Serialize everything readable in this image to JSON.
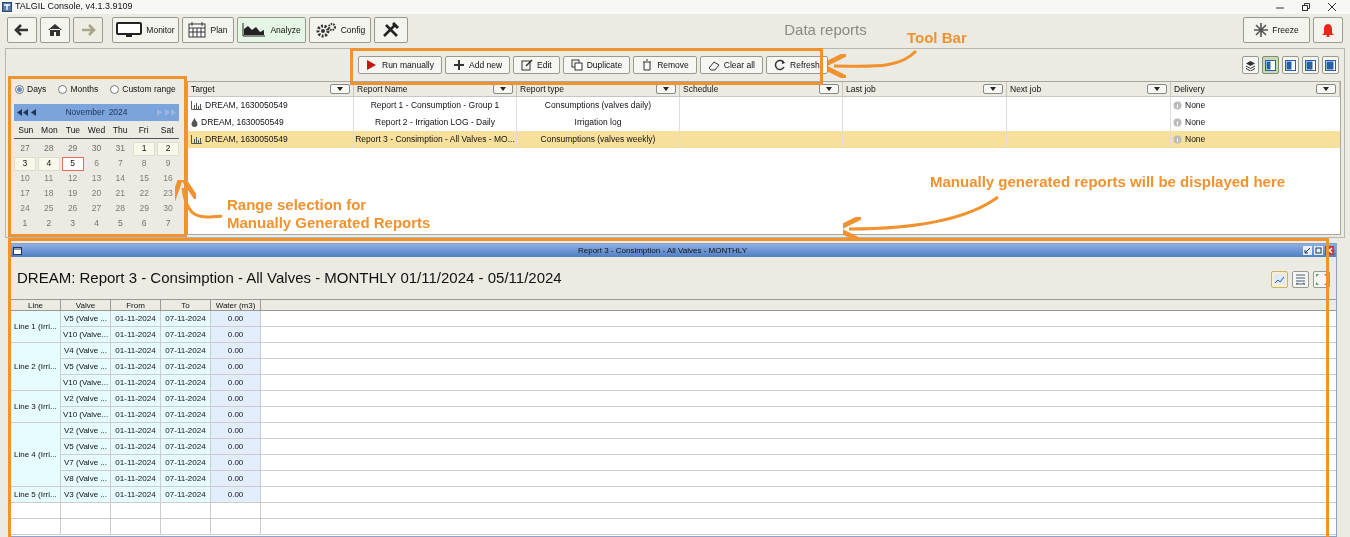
{
  "window": {
    "title": "TALGIL Console, v4.1.3.9109"
  },
  "nav_buttons": [
    {
      "kind": "back",
      "disabled": false
    },
    {
      "kind": "home",
      "disabled": false
    },
    {
      "kind": "forward",
      "disabled": true
    }
  ],
  "modules": [
    {
      "kind": "monitor",
      "label": "Monitor",
      "selected": false
    },
    {
      "kind": "plan",
      "label": "Plan",
      "selected": false
    },
    {
      "kind": "analyze",
      "label": "Analyze",
      "selected": true
    },
    {
      "kind": "config",
      "label": "Config",
      "selected": false
    },
    {
      "kind": "tools",
      "selected": false
    }
  ],
  "page_title": "Data reports",
  "freeze_button": {
    "label": "Freeze"
  },
  "actions": [
    {
      "kind": "run",
      "label": "Run manually"
    },
    {
      "kind": "add",
      "label": "Add new"
    },
    {
      "kind": "edit",
      "label": "Edit"
    },
    {
      "kind": "duplicate",
      "label": "Duplicate"
    },
    {
      "kind": "remove",
      "label": "Remove"
    },
    {
      "kind": "clear",
      "label": "Clear all"
    },
    {
      "kind": "refresh",
      "label": "Refresh"
    }
  ],
  "view_buttons": [
    {
      "kind": "layers",
      "selected": false
    },
    {
      "kind": "layout",
      "selected": true
    },
    {
      "kind": "layout",
      "selected": false
    },
    {
      "kind": "layout",
      "selected": false
    },
    {
      "kind": "layout",
      "selected": false
    }
  ],
  "calendar": {
    "range_modes": [
      {
        "label": "Days",
        "selected": true
      },
      {
        "label": "Months",
        "selected": false
      },
      {
        "label": "Custom range",
        "selected": false
      }
    ],
    "month": "November",
    "year": "2024",
    "weekdays": [
      "Sun",
      "Mon",
      "Tue",
      "Wed",
      "Thu",
      "Fri",
      "Sat"
    ],
    "days": [
      {
        "label": "27",
        "kind": "outside"
      },
      {
        "label": "28",
        "kind": "outside"
      },
      {
        "label": "29",
        "kind": "outside"
      },
      {
        "label": "30",
        "kind": "outside"
      },
      {
        "label": "31",
        "kind": "outside"
      },
      {
        "label": "1",
        "kind": "available"
      },
      {
        "label": "2",
        "kind": "available"
      },
      {
        "label": "3",
        "kind": "available"
      },
      {
        "label": "4",
        "kind": "available"
      },
      {
        "label": "5",
        "kind": "today"
      },
      {
        "label": "6",
        "kind": "future"
      },
      {
        "label": "7",
        "kind": "future"
      },
      {
        "label": "8",
        "kind": "future"
      },
      {
        "label": "9",
        "kind": "future"
      },
      {
        "label": "10",
        "kind": "future"
      },
      {
        "label": "11",
        "kind": "future"
      },
      {
        "label": "12",
        "kind": "future"
      },
      {
        "label": "13",
        "kind": "future"
      },
      {
        "label": "14",
        "kind": "future"
      },
      {
        "label": "15",
        "kind": "future"
      },
      {
        "label": "16",
        "kind": "future"
      },
      {
        "label": "17",
        "kind": "future"
      },
      {
        "label": "18",
        "kind": "future"
      },
      {
        "label": "19",
        "kind": "future"
      },
      {
        "label": "20",
        "kind": "future"
      },
      {
        "label": "21",
        "kind": "future"
      },
      {
        "label": "22",
        "kind": "future"
      },
      {
        "label": "23",
        "kind": "future"
      },
      {
        "label": "24",
        "kind": "future"
      },
      {
        "label": "25",
        "kind": "future"
      },
      {
        "label": "26",
        "kind": "future"
      },
      {
        "label": "27",
        "kind": "future"
      },
      {
        "label": "28",
        "kind": "future"
      },
      {
        "label": "29",
        "kind": "future"
      },
      {
        "label": "30",
        "kind": "future"
      },
      {
        "label": "1",
        "kind": "outside"
      },
      {
        "label": "2",
        "kind": "outside"
      },
      {
        "label": "3",
        "kind": "outside"
      },
      {
        "label": "4",
        "kind": "outside"
      },
      {
        "label": "5",
        "kind": "outside"
      },
      {
        "label": "6",
        "kind": "outside"
      },
      {
        "label": "7",
        "kind": "outside"
      }
    ]
  },
  "reports_table": {
    "columns": [
      "Target",
      "Report Name",
      "Report type",
      "Schedule",
      "Last job",
      "Next job",
      "Delivery"
    ],
    "rows": [
      {
        "kind": "chart",
        "target": "DREAM, 1630050549",
        "name": "Report 1 - Consumption - Group 1",
        "type": "Consumptions (valves daily)",
        "delivery": "None",
        "selected": false
      },
      {
        "kind": "drop",
        "target": "DREAM, 1630050549",
        "name": "Report 2 - Irrigation LOG - Daily",
        "type": "Irrigation log",
        "delivery": "None",
        "selected": false
      },
      {
        "kind": "chart",
        "target": "DREAM, 1630050549",
        "name": "Report 3 - Consimption - All Valves - MO...",
        "type": "Consumptions (valves weekly)",
        "delivery": "None",
        "selected": true
      }
    ]
  },
  "report_window": {
    "title": "Report 3 - Consimption - All Valves - MONTHLY",
    "heading": "DREAM: Report 3 - Consimption - All Valves - MONTHLY 01/11/2024 - 05/11/2024",
    "columns": [
      "Line",
      "Valve",
      "From",
      "To",
      "Water (m3)"
    ],
    "groups": [
      {
        "line": "Line 1 (Irri...",
        "rows": [
          {
            "valve": "V5 (Valve ...",
            "from": "01-11-2024",
            "to": "07-11-2024",
            "water": "0.00"
          },
          {
            "valve": "V10 (Valve...",
            "from": "01-11-2024",
            "to": "07-11-2024",
            "water": "0.00"
          }
        ]
      },
      {
        "line": "Line 2 (Irri...",
        "rows": [
          {
            "valve": "V4 (Valve ...",
            "from": "01-11-2024",
            "to": "07-11-2024",
            "water": "0.00"
          },
          {
            "valve": "V5 (Valve ...",
            "from": "01-11-2024",
            "to": "07-11-2024",
            "water": "0.00"
          },
          {
            "valve": "V10 (Valve...",
            "from": "01-11-2024",
            "to": "07-11-2024",
            "water": "0.00"
          }
        ]
      },
      {
        "line": "Line 3 (Irri...",
        "rows": [
          {
            "valve": "V2 (Valve ...",
            "from": "01-11-2024",
            "to": "07-11-2024",
            "water": "0.00"
          },
          {
            "valve": "V10 (Valve...",
            "from": "01-11-2024",
            "to": "07-11-2024",
            "water": "0.00"
          }
        ]
      },
      {
        "line": "Line 4 (Irri...",
        "rows": [
          {
            "valve": "V2 (Valve ...",
            "from": "01-11-2024",
            "to": "07-11-2024",
            "water": "0.00"
          },
          {
            "valve": "V5 (Valve ...",
            "from": "01-11-2024",
            "to": "07-11-2024",
            "water": "0.00"
          },
          {
            "valve": "V7 (Valve ...",
            "from": "01-11-2024",
            "to": "07-11-2024",
            "water": "0.00"
          },
          {
            "valve": "V8 (Valve ...",
            "from": "01-11-2024",
            "to": "07-11-2024",
            "water": "0.00"
          }
        ]
      },
      {
        "line": "Line 5 (Irri...",
        "rows": [
          {
            "valve": "V3 (Valve ...",
            "from": "01-11-2024",
            "to": "07-11-2024",
            "water": "0.00"
          }
        ]
      }
    ]
  },
  "annotations": [
    {
      "kind": "toolbar",
      "lines": [
        "Tool Bar"
      ]
    },
    {
      "kind": "calendar",
      "lines": [
        "Range selection for",
        "Manually Generated Reports"
      ]
    },
    {
      "kind": "report",
      "lines": [
        "Manually generated reports will be displayed here"
      ]
    }
  ]
}
